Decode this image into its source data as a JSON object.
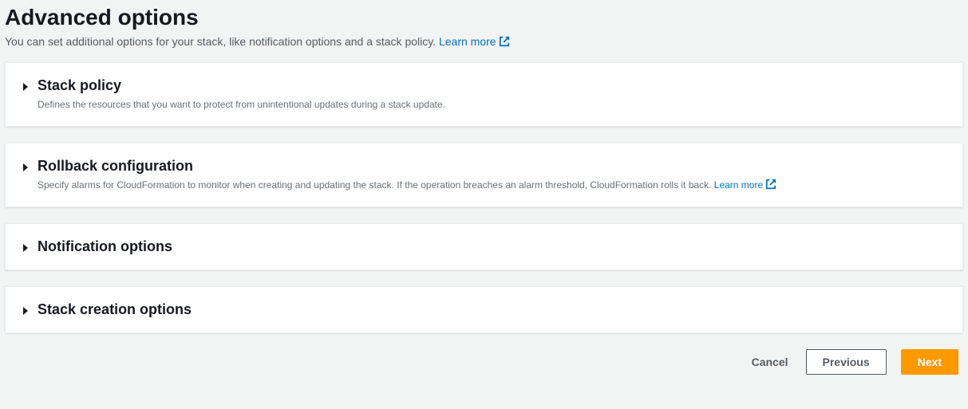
{
  "header": {
    "title": "Advanced options",
    "subtitle_pre": "You can set additional options for your stack, like notification options and a stack policy. ",
    "learn_more": "Learn more"
  },
  "panels": {
    "stack_policy": {
      "title": "Stack policy",
      "desc": "Defines the resources that you want to protect from unintentional updates during a stack update."
    },
    "rollback": {
      "title": "Rollback configuration",
      "desc_pre": "Specify alarms for CloudFormation to monitor when creating and updating the stack. If the operation breaches an alarm threshold, CloudFormation rolls it back. ",
      "learn_more": "Learn more"
    },
    "notification": {
      "title": "Notification options"
    },
    "stack_creation": {
      "title": "Stack creation options"
    }
  },
  "footer": {
    "cancel": "Cancel",
    "previous": "Previous",
    "next": "Next"
  }
}
